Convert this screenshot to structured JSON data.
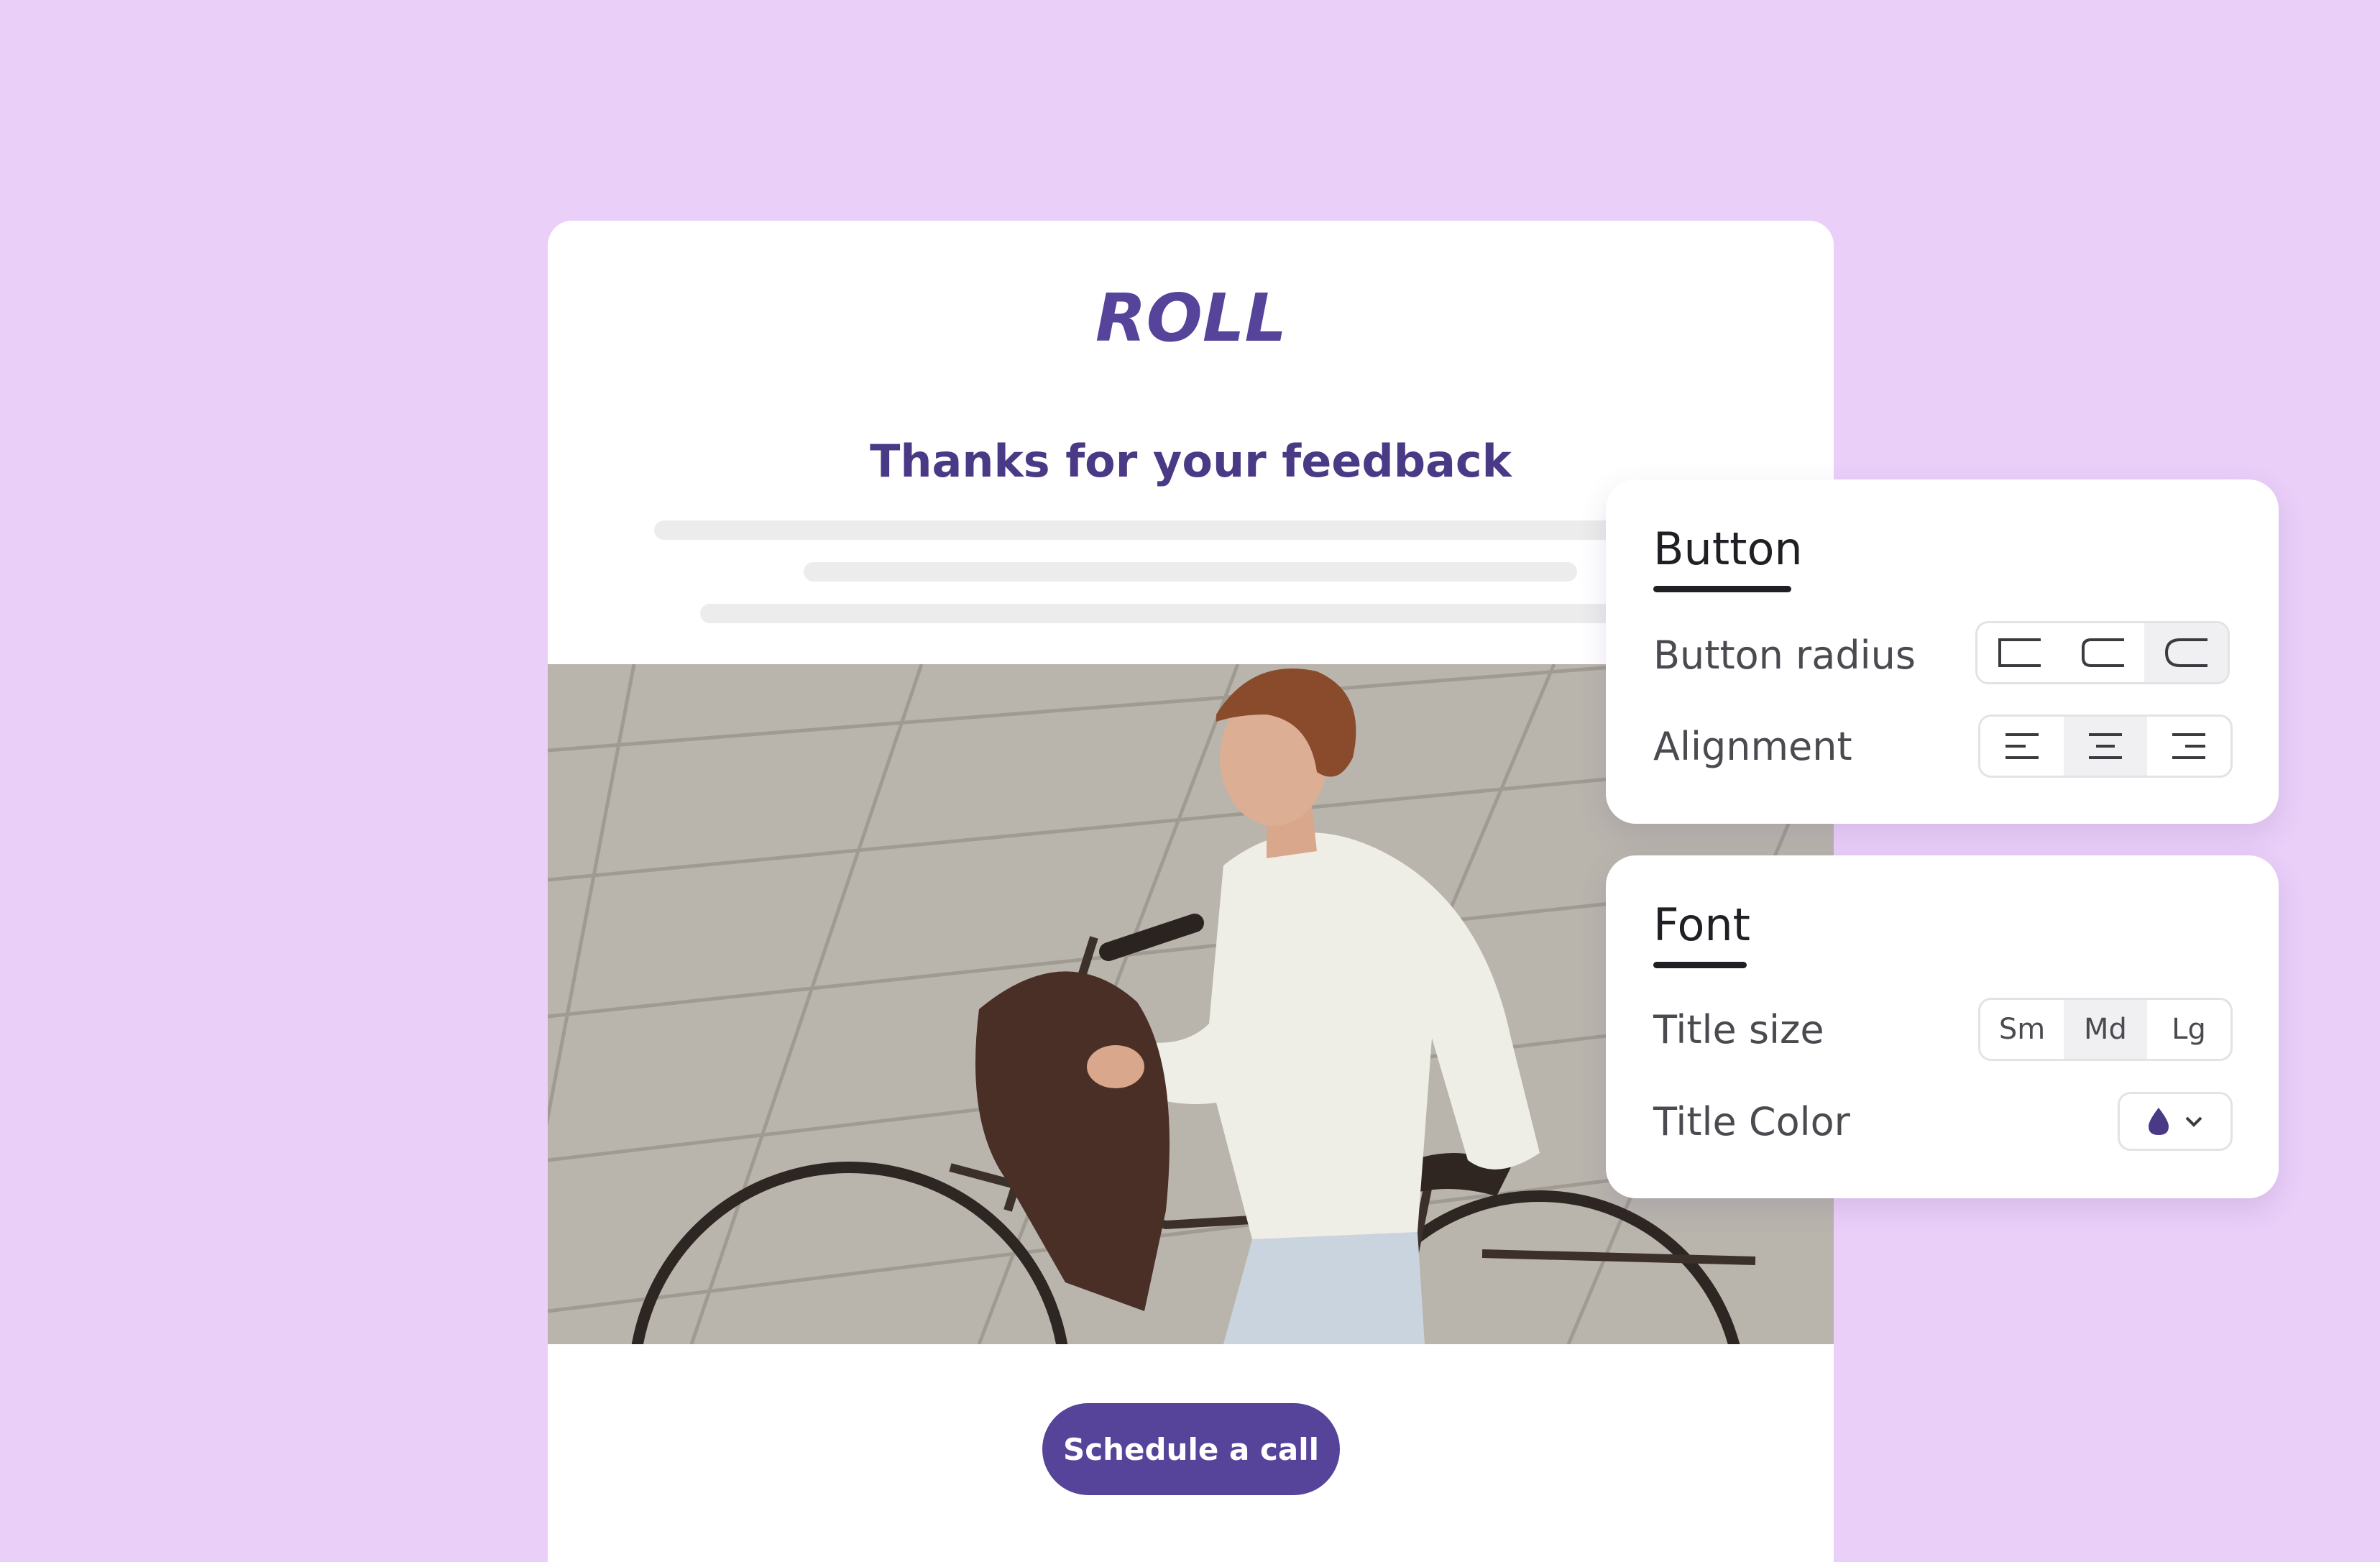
{
  "email": {
    "logo_text": "ROLL",
    "title": "Thanks for your feedback",
    "cta_label": "Schedule a call"
  },
  "panels": {
    "button": {
      "heading": "Button",
      "radius_label": "Button radius",
      "radius_options": [
        "square-corner-icon",
        "rounded-corner-icon",
        "pill-corner-icon"
      ],
      "radius_selected": "pill",
      "alignment_label": "Alignment",
      "alignment_options": [
        "align-left-icon",
        "align-center-icon",
        "align-right-icon"
      ],
      "alignment_selected": "center"
    },
    "font": {
      "heading": "Font",
      "title_size_label": "Title size",
      "size_options": [
        "Sm",
        "Md",
        "Lg"
      ],
      "size_selected": "Md",
      "title_color_label": "Title Color",
      "title_color_value": "#4a3a86"
    }
  },
  "colors": {
    "background": "#eacff9",
    "brand": "#56439a",
    "title": "#4a3a86"
  }
}
